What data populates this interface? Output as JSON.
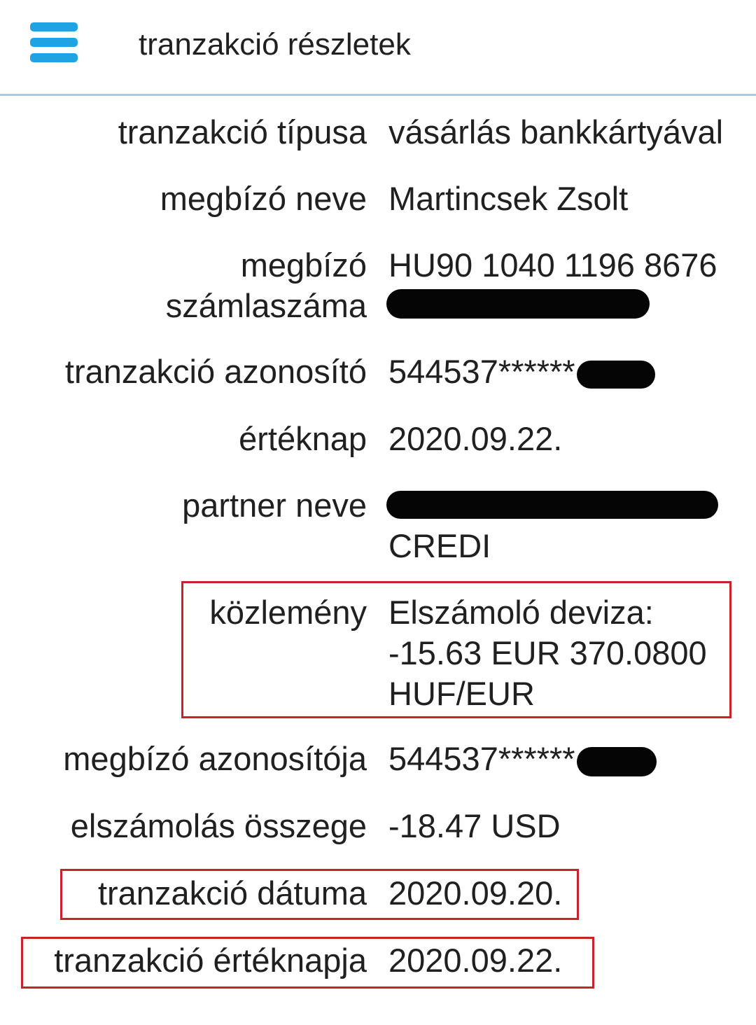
{
  "header": {
    "title": "tranzakció részletek",
    "menu_icon": "hamburger-menu-icon",
    "accent_color": "#1fa3e3",
    "divider_color": "#a9c9e0"
  },
  "highlight_color": "#c8232c",
  "details": {
    "type": {
      "label": "tranzakció típusa",
      "value": "vásárlás bankkártyával"
    },
    "payer_name": {
      "label": "megbízó neve",
      "value": "Martincsek Zsolt"
    },
    "payer_account": {
      "label_1": "megbízó",
      "label_2": "számlaszáma",
      "value": "HU90 1040 1196 8676"
    },
    "transaction_id": {
      "label": "tranzakció azonosító",
      "value": "544537******"
    },
    "value_date": {
      "label": "értéknap",
      "value": "2020.09.22."
    },
    "partner_name": {
      "label": "partner neve",
      "value_2": "CREDI"
    },
    "note": {
      "label": "közlemény",
      "line_1": "Elszámoló deviza:",
      "line_2": "-15.63 EUR 370.0800",
      "line_3": "HUF/EUR"
    },
    "payer_id": {
      "label": "megbízó azonosítója",
      "value": "544537******"
    },
    "settlement_amount": {
      "label": "elszámolás összege",
      "value": "-18.47 USD"
    },
    "transaction_date": {
      "label": "tranzakció dátuma",
      "value": "2020.09.20."
    },
    "transaction_value_date": {
      "label": "tranzakció értéknapja",
      "value": "2020.09.22."
    }
  }
}
